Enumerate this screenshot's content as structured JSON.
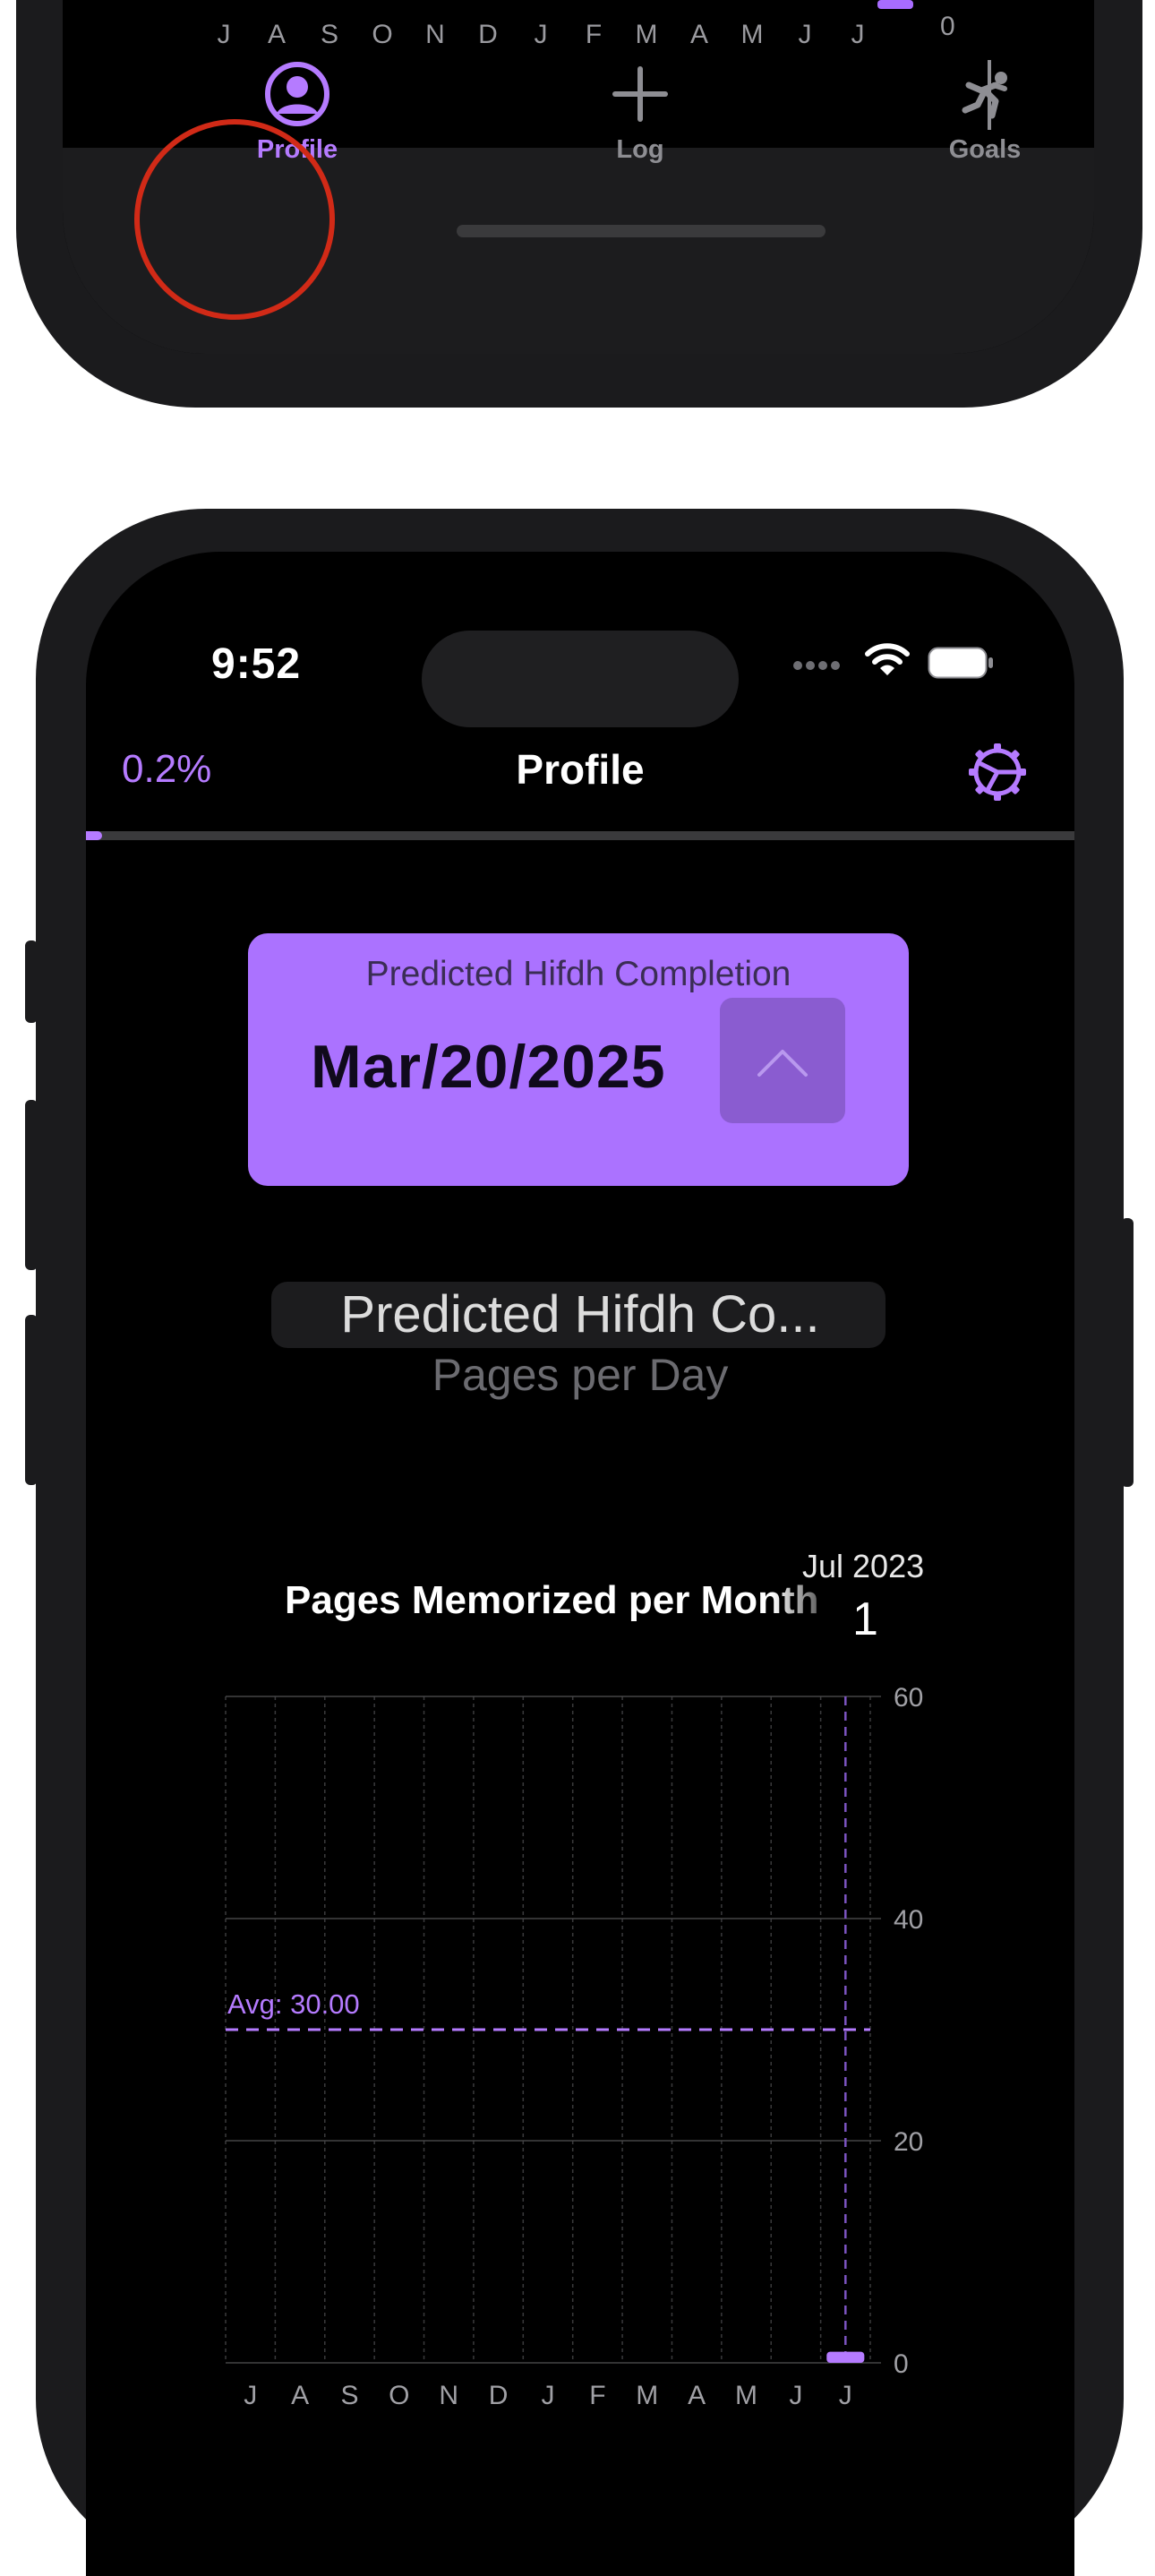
{
  "top_phone": {
    "x_labels": [
      "J",
      "A",
      "S",
      "O",
      "N",
      "D",
      "J",
      "F",
      "M",
      "A",
      "M",
      "J",
      "J"
    ],
    "zero_label": "0",
    "tabs": [
      {
        "label": "Profile",
        "icon": "person-circle-icon",
        "active": true
      },
      {
        "label": "Log",
        "icon": "plus-icon",
        "active": false
      },
      {
        "label": "Goals",
        "icon": "climber-icon",
        "active": false
      }
    ]
  },
  "status": {
    "time": "9:52"
  },
  "nav": {
    "percent": "0.2%",
    "title": "Profile",
    "progress": 0.002
  },
  "prediction": {
    "label": "Predicted Hifdh Completion",
    "date": "Mar/20/2025"
  },
  "picker": {
    "selected": "Predicted Hifdh Co...",
    "next": "Pages per Day"
  },
  "chart": {
    "title": "Pages Memorized per Month",
    "tooltip_date": "Jul 2023",
    "tooltip_value": "1",
    "avg_label": "Avg: 30.00"
  },
  "colors": {
    "accent": "#b57bff",
    "card": "#ab72ff",
    "highlight": "#d12a17"
  },
  "chart_data": {
    "type": "bar",
    "categories": [
      "J",
      "A",
      "S",
      "O",
      "N",
      "D",
      "J",
      "F",
      "M",
      "A",
      "M",
      "J",
      "J"
    ],
    "values": [
      0,
      0,
      0,
      0,
      0,
      0,
      0,
      0,
      0,
      0,
      0,
      0,
      1
    ],
    "ylim": [
      0,
      60
    ],
    "yticks": [
      0,
      20,
      40,
      60
    ],
    "average": 30.0,
    "selected_index": 12,
    "grid": true
  }
}
